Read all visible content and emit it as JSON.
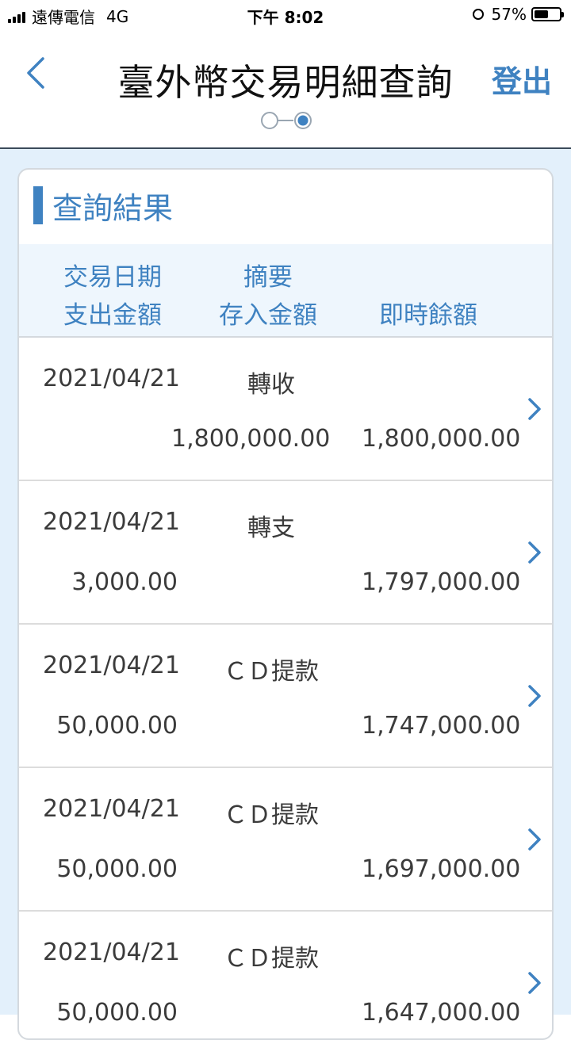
{
  "status_bar": {
    "carrier": "遠傳電信",
    "network": "4G",
    "time": "下午 8:02",
    "battery": "57%",
    "battery_level": 0.57
  },
  "header": {
    "title": "臺外幣交易明細查詢",
    "logout_label": "登出"
  },
  "card": {
    "title": "查詢結果"
  },
  "table": {
    "headers": {
      "date": "交易日期",
      "summary": "摘要",
      "debit": "支出金額",
      "credit": "存入金額",
      "balance": "即時餘額"
    },
    "rows": [
      {
        "date": "2021/04/21",
        "summary": "轉收",
        "debit": "",
        "credit": "1,800,000.00",
        "balance": "1,800,000.00"
      },
      {
        "date": "2021/04/21",
        "summary": "轉支",
        "debit": "3,000.00",
        "credit": "",
        "balance": "1,797,000.00"
      },
      {
        "date": "2021/04/21",
        "summary": "ＣＤ提款",
        "debit": "50,000.00",
        "credit": "",
        "balance": "1,747,000.00"
      },
      {
        "date": "2021/04/21",
        "summary": "ＣＤ提款",
        "debit": "50,000.00",
        "credit": "",
        "balance": "1,697,000.00"
      },
      {
        "date": "2021/04/21",
        "summary": "ＣＤ提款",
        "debit": "50,000.00",
        "credit": "",
        "balance": "1,647,000.00"
      }
    ]
  },
  "colors": {
    "accent": "#3f82c1",
    "content_background": "#e3f0fb",
    "header_background": "#eef6fd"
  }
}
